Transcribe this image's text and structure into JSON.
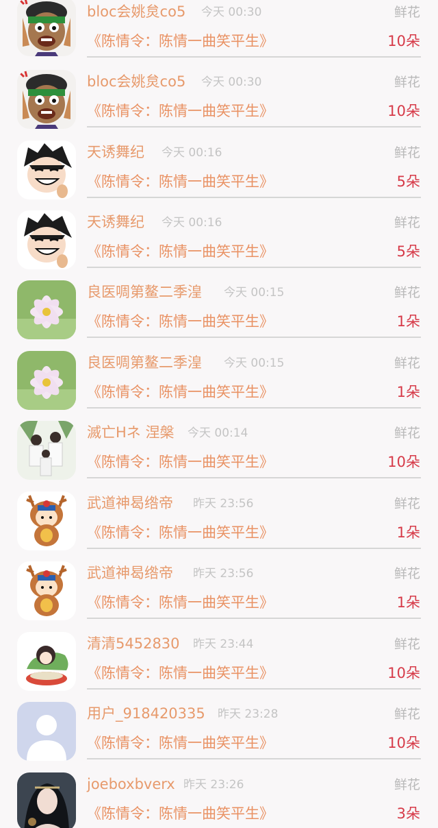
{
  "gift_list": {
    "items": [
      {
        "name": "bloc会姚炱co5",
        "time": "今天 00:30",
        "gift_type": "鲜花",
        "book": "《陈情令：陈情一曲笑平生》",
        "count": "10朵",
        "avatar": "cartoon-face-icon"
      },
      {
        "name": "bloc会姚炱co5",
        "time": "今天 00:30",
        "gift_type": "鲜花",
        "book": "《陈情令：陈情一曲笑平生》",
        "count": "10朵",
        "avatar": "cartoon-face-icon"
      },
      {
        "name": "天诱舞纪",
        "time": "今天 00:16",
        "gift_type": "鲜花",
        "book": "《陈情令：陈情一曲笑平生》",
        "count": "5朵",
        "avatar": "grinning-boy-icon"
      },
      {
        "name": "天诱舞纪",
        "time": "今天 00:16",
        "gift_type": "鲜花",
        "book": "《陈情令：陈情一曲笑平生》",
        "count": "5朵",
        "avatar": "grinning-boy-icon"
      },
      {
        "name": "良医啁第鳌二季湟",
        "time": "今天 00:15",
        "gift_type": "鲜花",
        "book": "《陈情令：陈情一曲笑平生》",
        "count": "1朵",
        "avatar": "cosmos-flower-icon"
      },
      {
        "name": "良医啁第鳌二季湟",
        "time": "今天 00:15",
        "gift_type": "鲜花",
        "book": "《陈情令：陈情一曲笑平生》",
        "count": "1朵",
        "avatar": "cosmos-flower-icon"
      },
      {
        "name": "滅亡Hネ 涅槃",
        "time": "今天 00:14",
        "gift_type": "鲜花",
        "book": "《陈情令：陈情一曲笑平生》",
        "count": "10朵",
        "avatar": "group-photo-icon"
      },
      {
        "name": "武道神曷绺帝",
        "time": "昨天 23:56",
        "gift_type": "鲜花",
        "book": "《陈情令：陈情一曲笑平生》",
        "count": "1朵",
        "avatar": "reindeer-kid-icon"
      },
      {
        "name": "武道神曷绺帝",
        "time": "昨天 23:56",
        "gift_type": "鲜花",
        "book": "《陈情令：陈情一曲笑平生》",
        "count": "1朵",
        "avatar": "reindeer-kid-icon"
      },
      {
        "name": "清清5452830",
        "time": "昨天 23:44",
        "gift_type": "鲜花",
        "book": "《陈情令：陈情一曲笑平生》",
        "count": "10朵",
        "avatar": "anime-girl-icon"
      },
      {
        "name": "用户_918420335",
        "time": "昨天 23:28",
        "gift_type": "鲜花",
        "book": "《陈情令：陈情一曲笑平生》",
        "count": "10朵",
        "avatar": "default-user-icon"
      },
      {
        "name": "joeboxbverx",
        "time": "昨天 23:26",
        "gift_type": "鲜花",
        "book": "《陈情令：陈情一曲笑平生》",
        "count": "3朵",
        "avatar": "portrait-photo-icon"
      }
    ]
  },
  "colors": {
    "background": "#f9f7f8",
    "name": "#e79a6c",
    "time": "#c4c4c4",
    "book": "#e99264",
    "count": "#d63a48",
    "divider": "#d6d6d6"
  }
}
